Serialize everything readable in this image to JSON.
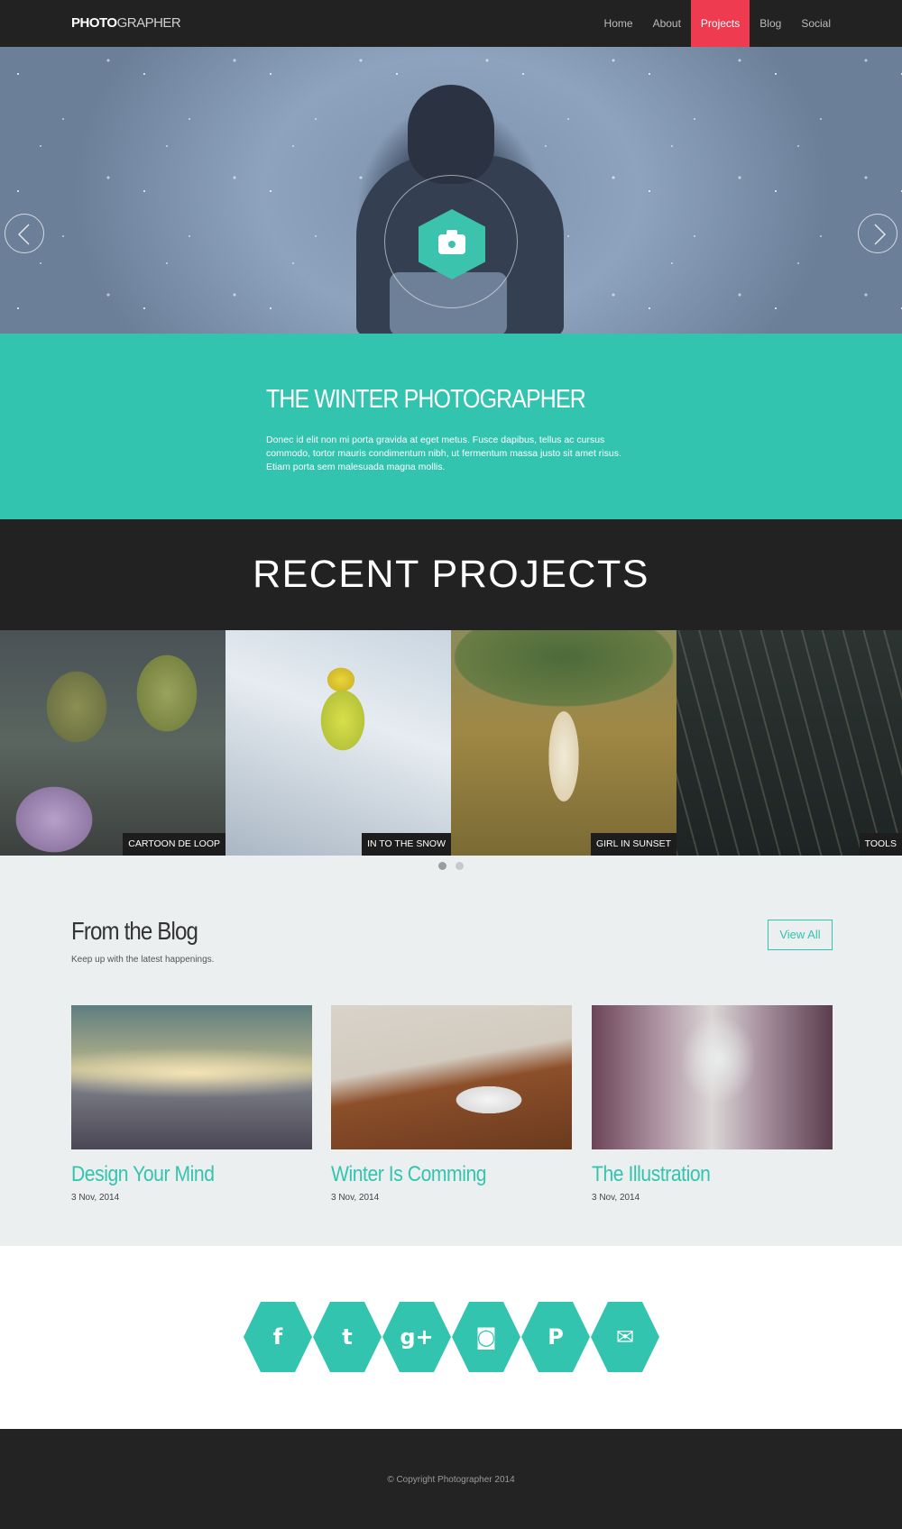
{
  "brand": {
    "strong": "PHOTO",
    "light": "GRAPHER"
  },
  "nav": {
    "items": [
      {
        "label": "Home"
      },
      {
        "label": "About"
      },
      {
        "label": "Projects",
        "active": true
      },
      {
        "label": "Blog"
      },
      {
        "label": "Social"
      }
    ],
    "active_color": "#ef3b4f"
  },
  "hero": {
    "icon": "camera-icon",
    "prev_icon": "chevron-left-icon",
    "next_icon": "chevron-right-icon"
  },
  "intro": {
    "title": "THE WINTER PHOTOGRAPHER",
    "text": "Donec id elit non mi porta gravida at eget metus. Fusce dapibus, tellus ac cursus commodo, tortor mauris condimentum nibh, ut fermentum massa justo sit amet risus. Etiam porta sem malesuada magna mollis."
  },
  "projects": {
    "title": "RECENT PROJECTS",
    "items": [
      {
        "label": "CARTOON DE LOOP"
      },
      {
        "label": "IN TO THE SNOW"
      },
      {
        "label": "GIRL IN SUNSET"
      },
      {
        "label": "TOOLS"
      }
    ],
    "pagination": {
      "pages": 2,
      "active": 1
    }
  },
  "blog": {
    "title": "From the Blog",
    "subtitle": "Keep up with the latest happenings.",
    "view_all": "View All",
    "posts": [
      {
        "title": "Design Your Mind",
        "date": "3 Nov, 2014"
      },
      {
        "title": "Winter Is Comming",
        "date": "3 Nov, 2014"
      },
      {
        "title": "The Illustration",
        "date": "3 Nov, 2014"
      }
    ]
  },
  "social": {
    "items": [
      {
        "icon": "facebook-icon",
        "glyph": "f"
      },
      {
        "icon": "twitter-icon",
        "glyph": "t"
      },
      {
        "icon": "google-plus-icon",
        "glyph": "g+"
      },
      {
        "icon": "instagram-icon",
        "glyph": "◙"
      },
      {
        "icon": "pinterest-icon",
        "glyph": "P"
      },
      {
        "icon": "email-icon",
        "glyph": "✉"
      }
    ]
  },
  "footer": {
    "copyright": "© Copyright Photographer 2014"
  },
  "colors": {
    "accent": "#33c4af",
    "dark": "#222222",
    "light_bg": "#eceff0"
  }
}
